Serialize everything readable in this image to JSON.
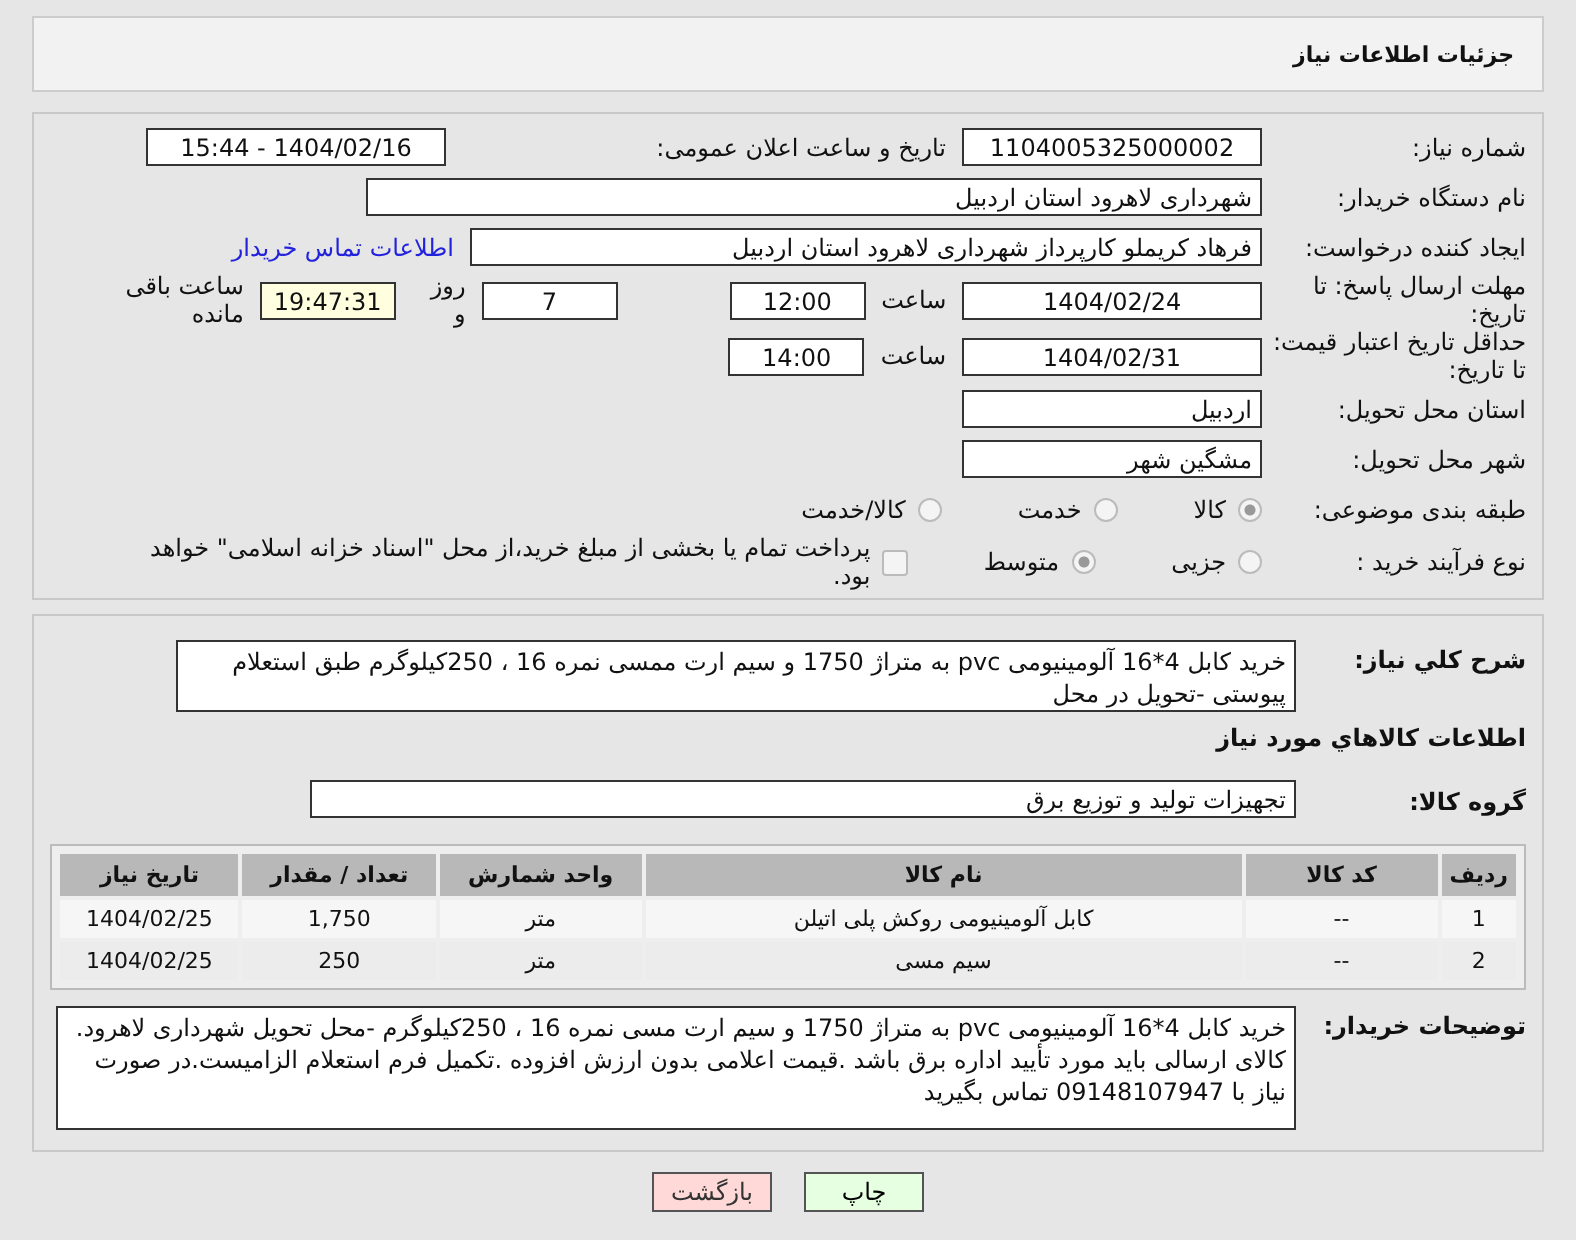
{
  "header": {
    "title": "جزئیات اطلاعات نیاز"
  },
  "need_number": {
    "label": "شماره نیاز:",
    "value": "1104005325000002"
  },
  "announce": {
    "label": "تاریخ و ساعت اعلان عمومی:",
    "value": "1404/02/16 - 15:44"
  },
  "buyer_org": {
    "label": "نام دستگاه خریدار:",
    "value": "شهرداری لاهرود استان اردبیل"
  },
  "creator": {
    "label": "ایجاد کننده درخواست:",
    "value": "فرهاد  کریملو کارپرداز  شهرداری لاهرود استان اردبیل",
    "link": "اطلاعات تماس خریدار"
  },
  "deadline": {
    "label": "مهلت ارسال پاسخ: تا تاریخ:",
    "date": "1404/02/24",
    "time_label": "ساعت",
    "time": "12:00",
    "days": "7",
    "days_label": "روز و",
    "remaining": "19:47:31",
    "remaining_label": "ساعت باقی مانده"
  },
  "validity": {
    "label": "حداقل تاریخ اعتبار قیمت: تا تاریخ:",
    "date": "1404/02/31",
    "time_label": "ساعت",
    "time": "14:00"
  },
  "province": {
    "label": "استان محل تحویل:",
    "value": "اردبیل"
  },
  "city": {
    "label": "شهر محل تحویل:",
    "value": "مشگین شهر"
  },
  "category": {
    "label": "طبقه بندی موضوعی:",
    "options": [
      {
        "label": "کالا",
        "selected": true
      },
      {
        "label": "خدمت",
        "selected": false
      },
      {
        "label": "کالا/خدمت",
        "selected": false
      }
    ]
  },
  "process": {
    "label": "نوع فرآیند خرید :",
    "options": [
      {
        "label": "جزیی",
        "selected": false
      },
      {
        "label": "متوسط",
        "selected": true
      }
    ],
    "payment": {
      "checked": false,
      "text": "پرداخت تمام یا بخشی از مبلغ خرید،از محل \"اسناد خزانه اسلامی\" خواهد بود."
    }
  },
  "description": {
    "label": "شرح کلي نياز:",
    "value": "خرید کابل 4*16 آلومینیومی pvc به متراژ 1750 و سیم ارت ممسی نمره 16 ، 250کیلوگرم طبق استعلام پیوستی -تحویل در محل"
  },
  "goods_title": "اطلاعات کالاهاي مورد نياز",
  "goods_group": {
    "label": "گروه کالا:",
    "value": "تجهیزات تولید و توزیع برق"
  },
  "table": {
    "columns": [
      "ردیف",
      "کد کالا",
      "نام کالا",
      "واحد شمارش",
      "تعداد / مقدار",
      "تاریخ نیاز"
    ],
    "rows": [
      [
        "1",
        "--",
        "کابل آلومینیومی روکش پلی اتیلن",
        "متر",
        "1,750",
        "1404/02/25"
      ],
      [
        "2",
        "--",
        "سیم مسی",
        "متر",
        "250",
        "1404/02/25"
      ]
    ]
  },
  "buyer_notes": {
    "label": "توضیحات خریدار:",
    "value": "خرید کابل 4*16 آلومینیومی pvc به متراژ 1750 و سیم ارت مسی نمره 16 ، 250کیلوگرم -محل تحویل شهرداری لاهرود. کالای ارسالی باید مورد تأیید اداره برق باشد .قیمت اعلامی بدون ارزش افزوده .تکمیل فرم استعلام الزامیست.در صورت نیاز با 09148107947 تماس بگیرید"
  },
  "buttons": [
    {
      "kind": "print",
      "label": "چاپ"
    },
    {
      "kind": "back",
      "label": "بازگشت"
    }
  ]
}
